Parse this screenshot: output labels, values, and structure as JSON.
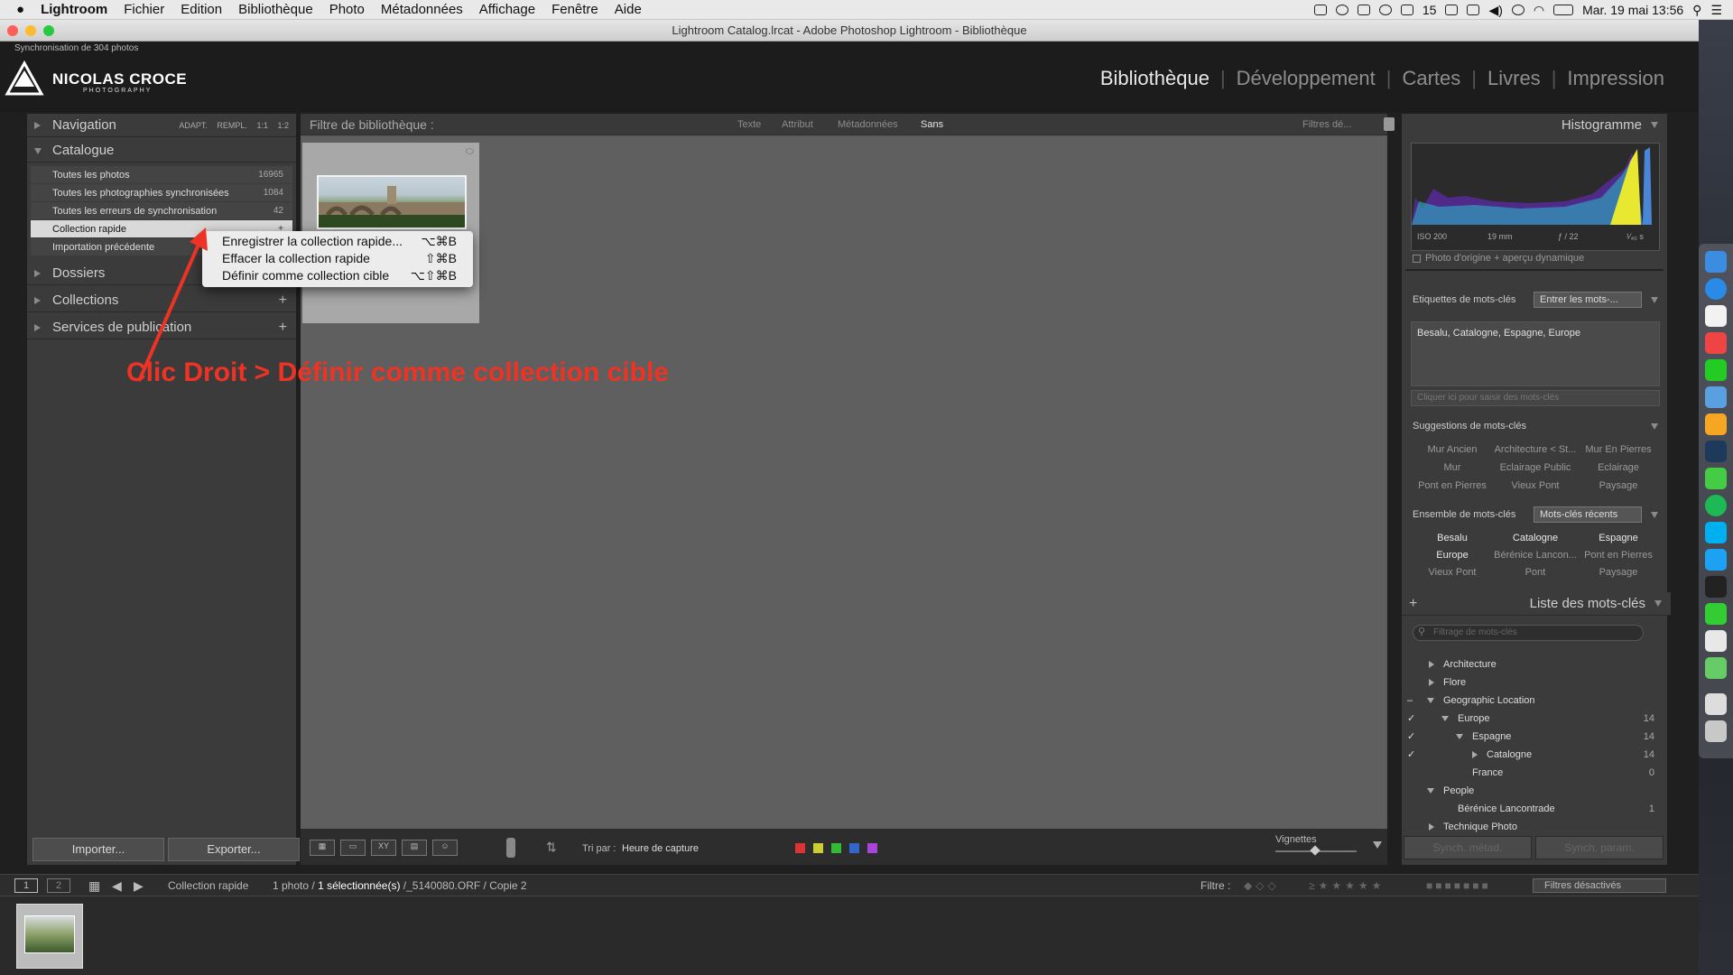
{
  "menubar": {
    "apple": "",
    "app": "Lightroom",
    "items": [
      "Fichier",
      "Edition",
      "Bibliothèque",
      "Photo",
      "Métadonnées",
      "Affichage",
      "Fenêtre",
      "Aide"
    ],
    "status_count": "15",
    "datetime": "Mar. 19 mai  13:56"
  },
  "window": {
    "title": "Lightroom Catalog.lrcat - Adobe Photoshop Lightroom - Bibliothèque",
    "sync_status": "Synchronisation de 304 photos",
    "brand_name": "NICOLAS CROCE",
    "brand_sub": "PHOTOGRAPHY"
  },
  "modules": {
    "library": "Bibliothèque",
    "develop": "Développement",
    "maps": "Cartes",
    "books": "Livres",
    "print": "Impression"
  },
  "left": {
    "navigator": "Navigation",
    "nav_modes": [
      "ADAPT.",
      "REMPL.",
      "1:1",
      "1:2"
    ],
    "catalog": "Catalogue",
    "catalog_items": [
      {
        "label": "Toutes les photos",
        "count": "16965"
      },
      {
        "label": "Toutes les photographies synchronisées",
        "count": "1084"
      },
      {
        "label": "Toutes les erreurs de synchronisation",
        "count": "42"
      },
      {
        "label": "Collection rapide",
        "count": "+"
      },
      {
        "label": "Importation précédente",
        "count": ""
      }
    ],
    "folders": "Dossiers",
    "collections": "Collections",
    "publish": "Services de publication",
    "import_btn": "Importer...",
    "export_btn": "Exporter..."
  },
  "context_menu": {
    "items": [
      {
        "label": "Enregistrer la collection rapide...",
        "key": "⌥⌘B"
      },
      {
        "label": "Effacer la collection rapide",
        "key": "⇧⌘B"
      },
      {
        "label": "Définir comme collection cible",
        "key": "⌥⇧⌘B"
      }
    ]
  },
  "annotation": "Clic Droit > Définir comme collection cible",
  "filterbar": {
    "title": "Filtre de bibliothèque :",
    "tabs": [
      "Texte",
      "Attribut",
      "Métadonnées",
      "Sans"
    ],
    "presets": "Filtres dé..."
  },
  "toolbar": {
    "sort_label": "Tri par :",
    "sort_value": "Heure de capture",
    "thumbs_label": "Vignettes",
    "label_colors": [
      "#d33",
      "#cc3",
      "#3b3",
      "#36c",
      "#a4d"
    ]
  },
  "right": {
    "histogram": "Histogramme",
    "exif": [
      "ISO 200",
      "19 mm",
      "ƒ / 22",
      "¹⁄₄₀ s"
    ],
    "preview": "Photo d'origine + aperçu dynamique",
    "kw_tags_label": "Etiquettes de mots-clés",
    "kw_tags_mode": "Entrer les mots-...",
    "kw_tags_value": "Besalu, Catalogne, Espagne, Europe",
    "kw_input_placeholder": "Cliquer ici pour saisir des mots-clés",
    "suggest_label": "Suggestions de mots-clés",
    "suggestions": [
      "Mur Ancien",
      "Architecture < St...",
      "Mur En Pierres",
      "Mur",
      "Eclairage Public",
      "Eclairage",
      "Pont en Pierres",
      "Vieux Pont",
      "Paysage"
    ],
    "set_label": "Ensemble de mots-clés",
    "set_mode": "Mots-clés récents",
    "set_items": [
      "Besalu",
      "Catalogne",
      "Espagne",
      "Europe",
      "Bérénice Lancon...",
      "Pont en Pierres",
      "Vieux Pont",
      "Pont",
      "Paysage"
    ],
    "kwlist_label": "Liste des mots-clés",
    "kwlist_search": "Filtrage de mots-clés",
    "kwlist": [
      {
        "label": "Architecture",
        "count": ""
      },
      {
        "label": "Flore",
        "count": ""
      },
      {
        "label": "Geographic Location",
        "count": ""
      },
      {
        "label": "Europe",
        "count": "14"
      },
      {
        "label": "Espagne",
        "count": "14"
      },
      {
        "label": "Catalogne",
        "count": "14"
      },
      {
        "label": "France",
        "count": "0"
      },
      {
        "label": "People",
        "count": ""
      },
      {
        "label": "Bérénice Lancontrade",
        "count": "1"
      },
      {
        "label": "Technique Photo",
        "count": ""
      }
    ],
    "sync_meta": "Synch. métad.",
    "sync_settings": "Synch. param."
  },
  "filmbar": {
    "page1": "1",
    "page2": "2",
    "source": "Collection rapide",
    "count_pre": "1 photo /",
    "count_sel": "1 sélectionnée(s)",
    "count_post": "/_5140080.ORF / Copie 2",
    "filter_label": "Filtre :",
    "filter_state": "Filtres désactivés"
  }
}
